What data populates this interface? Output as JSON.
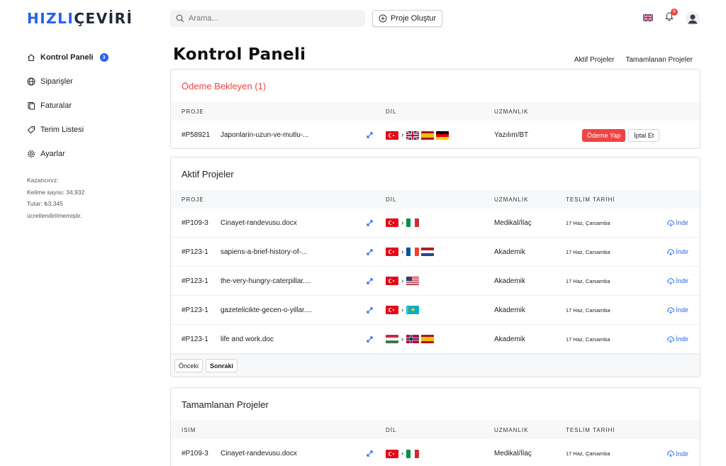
{
  "brand": {
    "part1": "HIZLI",
    "part2": "ÇEVİRİ"
  },
  "header": {
    "search_placeholder": "Arama...",
    "create_label": "Proje Oluştur",
    "notification_count": "6"
  },
  "sidebar": {
    "items": [
      {
        "label": "Kontrol Paneli",
        "count": "3",
        "active": true
      },
      {
        "label": "Siparişler"
      },
      {
        "label": "Faturalar"
      },
      {
        "label": "Terim Listesi"
      },
      {
        "label": "Ayarlar"
      }
    ],
    "earnings": {
      "title": "Kazancınız:",
      "words": "Kelime sayısı: 34,932",
      "amount": "Tutar: ₺3,345",
      "note": "ücretlendirilmemiştir."
    }
  },
  "main": {
    "title": "Kontrol Paneli",
    "links": {
      "active": "Aktif Projeler",
      "completed": "Tamamlanan Projeler"
    }
  },
  "pending": {
    "title": "Ödeme Bekleyen (1)",
    "headers": {
      "project": "PROJE",
      "lang": "DİL",
      "spec": "UZMANLIK"
    },
    "rows": [
      {
        "id": "#P58921",
        "name": "Japonlarin-uzun-ve-mutlu-...",
        "spec": "Yazılım/BT",
        "pay": "Ödeme Yap",
        "cancel": "İptal Et"
      }
    ]
  },
  "active": {
    "title": "Aktif Projeler",
    "headers": {
      "project": "PROJE",
      "lang": "DİL",
      "spec": "UZMANLIK",
      "date": "TESLİM TARİHİ"
    },
    "rows": [
      {
        "id": "#P109-3",
        "name": "Cinayet-randevusu.docx",
        "spec": "Medikal/İlaç",
        "date": "17 Haz, Çarsamba",
        "download": "İndir"
      },
      {
        "id": "#P123-1",
        "name": "sapiens-a-brief-history-of-...",
        "spec": "Akademik",
        "date": "17 Haz, Carsamba",
        "download": "İndir"
      },
      {
        "id": "#P123-1",
        "name": "the-very-hungry-caterpillar....",
        "spec": "Akademik",
        "date": "17 Haz, Carsamba",
        "download": "İndir"
      },
      {
        "id": "#P123-1",
        "name": "gazetelicikte-gecen-o-yillar....",
        "spec": "Akademik",
        "date": "17 Haz, Carsamba",
        "download": "İndir"
      },
      {
        "id": "#P123-1",
        "name": "life and work.doc",
        "spec": "Akademik",
        "date": "17 Haz, Carsamba",
        "download": "İndir"
      }
    ],
    "pager": {
      "prev": "Önceki",
      "next": "Sonraki"
    }
  },
  "completed": {
    "title": "Tamamlanan Projeler",
    "headers": {
      "name": "İSİM",
      "lang": "DİL",
      "spec": "UZMANLIK",
      "date": "TESLİM TARİHİ"
    },
    "rows": [
      {
        "id": "#P109-3",
        "name": "Cinayet-randevusu.docx",
        "spec": "Medikal/İlaç",
        "date": "17 Haz, Çarsamba",
        "download": "İndir"
      }
    ]
  },
  "icons": {
    "search": "search-icon",
    "create": "plus-circle-icon",
    "language": "uk-flag-icon",
    "bell": "bell-icon",
    "avatar": "user-avatar-icon",
    "expand": "expand-icon",
    "download": "cloud-download-icon"
  },
  "colors": {
    "accent": "#2563eb",
    "danger": "#ef4444"
  }
}
